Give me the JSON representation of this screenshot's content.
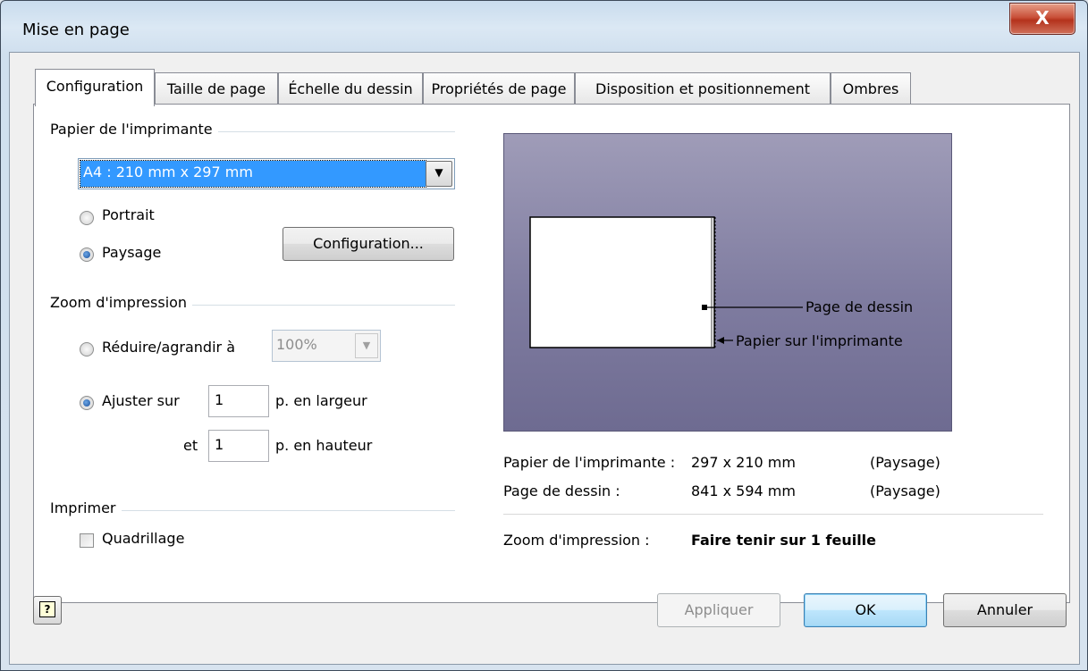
{
  "window": {
    "title": "Mise en page",
    "close_label": "X"
  },
  "tabs": [
    {
      "label": "Configuration"
    },
    {
      "label": "Taille de page"
    },
    {
      "label": "Échelle du dessin"
    },
    {
      "label": "Propriétés de page"
    },
    {
      "label": "Disposition et positionnement"
    },
    {
      "label": "Ombres"
    }
  ],
  "printer_paper": {
    "group_label": "Papier de l'imprimante",
    "paper_size": "A4 :  210 mm x 297 mm",
    "portrait_label": "Portrait",
    "landscape_label": "Paysage",
    "orientation": "landscape",
    "setup_button": "Configuration..."
  },
  "print_zoom": {
    "group_label": "Zoom d'impression",
    "reduce_label": "Réduire/agrandir à",
    "reduce_value": "100%",
    "fit_label": "Ajuster sur",
    "fit_width": "1",
    "width_suffix": "p. en largeur",
    "height_prefix": "et",
    "fit_height": "1",
    "height_suffix": "p. en hauteur",
    "mode": "fit"
  },
  "print": {
    "group_label": "Imprimer",
    "gridlines_label": "Quadrillage",
    "gridlines_checked": false
  },
  "preview": {
    "drawing_page_callout": "Page de dessin",
    "printer_paper_callout": "Papier sur l'imprimante"
  },
  "summary": {
    "printer_paper_label": "Papier de l'imprimante :",
    "printer_paper_value": "297 x 210 mm",
    "printer_paper_orientation": "(Paysage)",
    "drawing_page_label": "Page de dessin :",
    "drawing_page_value": "841 x 594 mm",
    "drawing_page_orientation": "(Paysage)",
    "zoom_label": "Zoom d'impression :",
    "zoom_value": "Faire tenir sur 1 feuille"
  },
  "buttons": {
    "apply": "Appliquer",
    "ok": "OK",
    "cancel": "Annuler",
    "help_icon": "?"
  },
  "colors": {
    "selection": "#3399ff",
    "preview_background": "#8886a8",
    "close_button": "#c9513a"
  }
}
